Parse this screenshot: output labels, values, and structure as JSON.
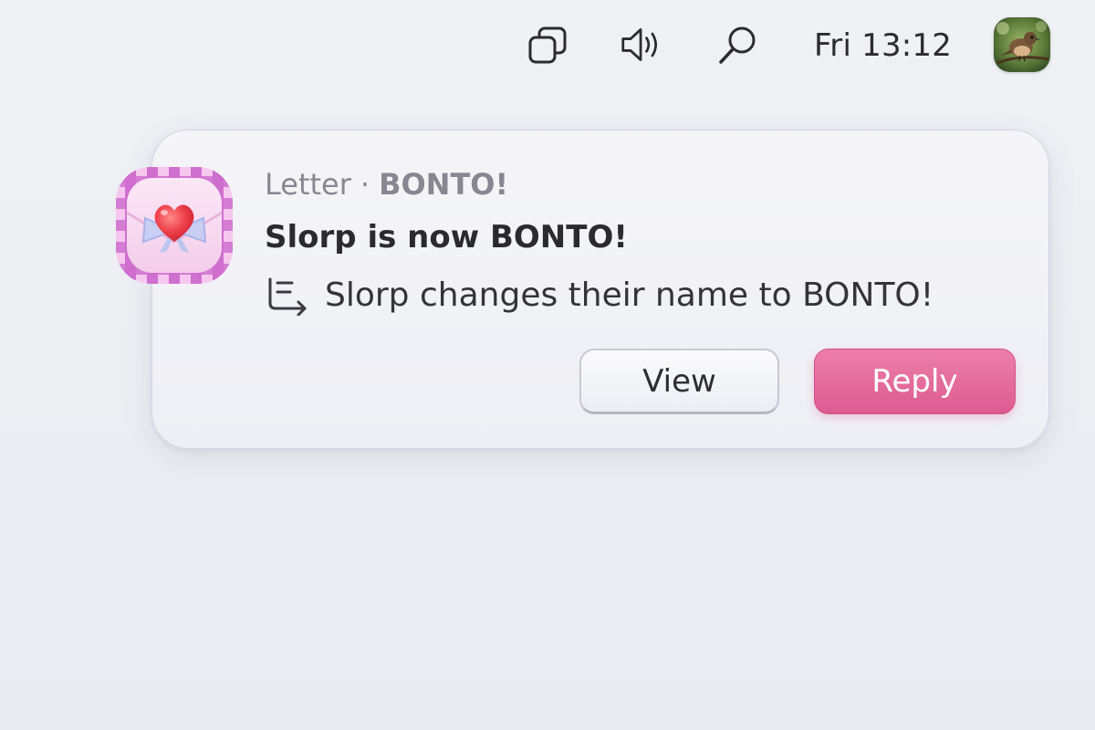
{
  "topbar": {
    "icons": {
      "windows": "window-switcher-icon",
      "volume": "speaker-icon",
      "search": "search-icon"
    },
    "clock": "Fri 13:12",
    "avatar": "user-avatar-bird"
  },
  "notification": {
    "app_icon": "letter-heart-icon",
    "app_name": "Letter",
    "separator": "·",
    "sender": "BONTO!",
    "title": "Slorp is now BONTO!",
    "body_icon": "reply-thread-icon",
    "body": "Slorp changes their name to BONTO!",
    "actions": {
      "view_label": "View",
      "reply_label": "Reply"
    }
  },
  "colors": {
    "reply_button": "#e06699",
    "card_background": "#f2f2f6",
    "app_icon_stripes": "#cf79cf"
  }
}
